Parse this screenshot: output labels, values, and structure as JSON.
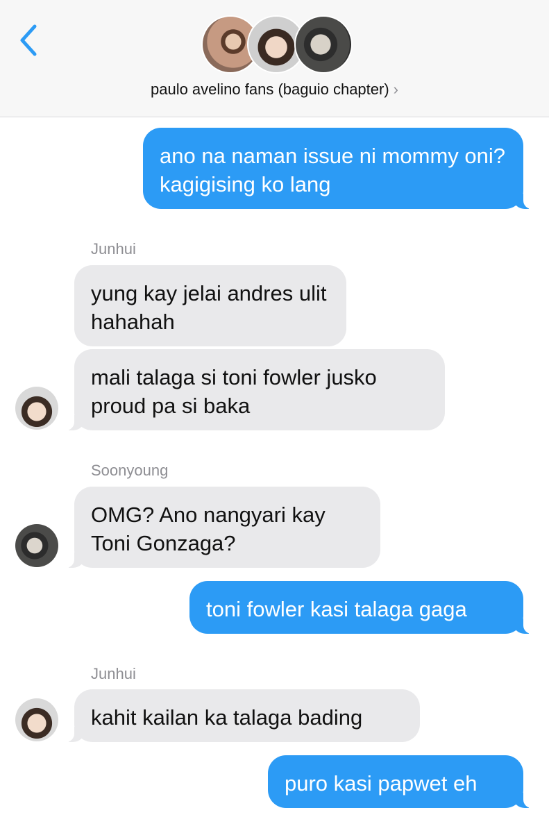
{
  "header": {
    "back_icon": "chevron-left-icon",
    "group_name": "paulo avelino fans (baguio chapter)",
    "title_chevron": "›",
    "accent_color": "#2c9bf5"
  },
  "messages": [
    {
      "direction": "outgoing",
      "text": "ano na naman issue ni mommy oni? kagigising ko lang"
    },
    {
      "direction": "incoming",
      "sender": "Junhui",
      "text": "yung kay jelai andres ulit hahahah"
    },
    {
      "direction": "incoming",
      "sender": "Junhui",
      "text": "mali talaga si toni fowler jusko proud pa si baka"
    },
    {
      "direction": "incoming",
      "sender": "Soonyoung",
      "text": "OMG? Ano nangyari kay Toni Gonzaga?"
    },
    {
      "direction": "outgoing",
      "text": "toni fowler kasi talaga gaga"
    },
    {
      "direction": "incoming",
      "sender": "Junhui",
      "text": "kahit kailan ka talaga bading"
    },
    {
      "direction": "outgoing",
      "text": "puro kasi papwet eh"
    }
  ],
  "colors": {
    "outgoing_bubble": "#2c9bf5",
    "incoming_bubble": "#e9e9eb",
    "sender_label": "#8e8e93"
  }
}
